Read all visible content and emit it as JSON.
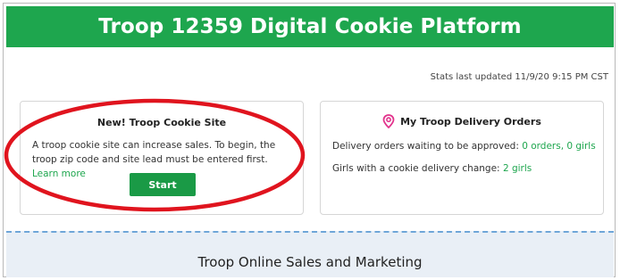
{
  "header": {
    "title": "Troop 12359 Digital Cookie Platform"
  },
  "stats": {
    "text": "Stats last updated 11/9/20 9:15 PM CST"
  },
  "cookie_site_card": {
    "title": "New! Troop Cookie Site",
    "body": "A troop cookie site can increase sales. To begin, the troop zip code and site lead must be entered first.",
    "link_label": "Learn more",
    "button_label": "Start"
  },
  "delivery_card": {
    "title": "My Troop Delivery Orders",
    "icon": "location-pin-icon",
    "rows": [
      {
        "label": "Delivery orders waiting to be approved:",
        "value": "0 orders, 0 girls"
      },
      {
        "label": "Girls with a cookie delivery change:",
        "value": "2 girls"
      }
    ]
  },
  "section": {
    "title": "Troop Online Sales and Marketing"
  },
  "colors": {
    "brand_green": "#1ea64e",
    "callout_red": "#e0141e",
    "section_bg": "#e9eff6"
  }
}
